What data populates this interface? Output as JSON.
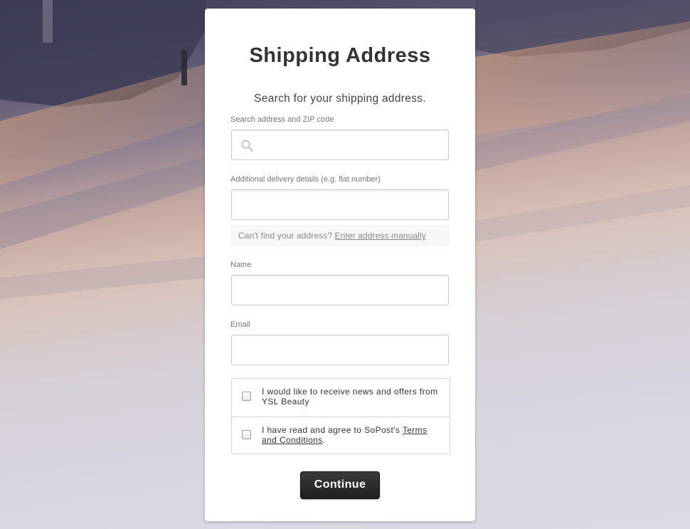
{
  "page": {
    "title": "Shipping Address",
    "subtitle": "Search for your shipping address."
  },
  "fields": {
    "search": {
      "label": "Search address and ZIP code",
      "value": "",
      "icon": "search-icon"
    },
    "details": {
      "label": "Additional delivery details (e.g. flat number)",
      "value": ""
    },
    "name": {
      "label": "Name",
      "value": ""
    },
    "email": {
      "label": "Email",
      "value": ""
    }
  },
  "manual_entry": {
    "prompt": "Can't find your address?",
    "link_label": "Enter address manually"
  },
  "consents": {
    "news": {
      "label": "I would like to receive news and offers from YSL Beauty",
      "checked": false
    },
    "terms": {
      "prefix": "I have read and agree to SoPost's",
      "link_label": "Terms and Conditions",
      "suffix": ".",
      "checked": false
    }
  },
  "actions": {
    "continue_label": "Continue"
  },
  "colors": {
    "button": "#2a2a2a",
    "card": "#ffffff",
    "label": "#777777"
  }
}
